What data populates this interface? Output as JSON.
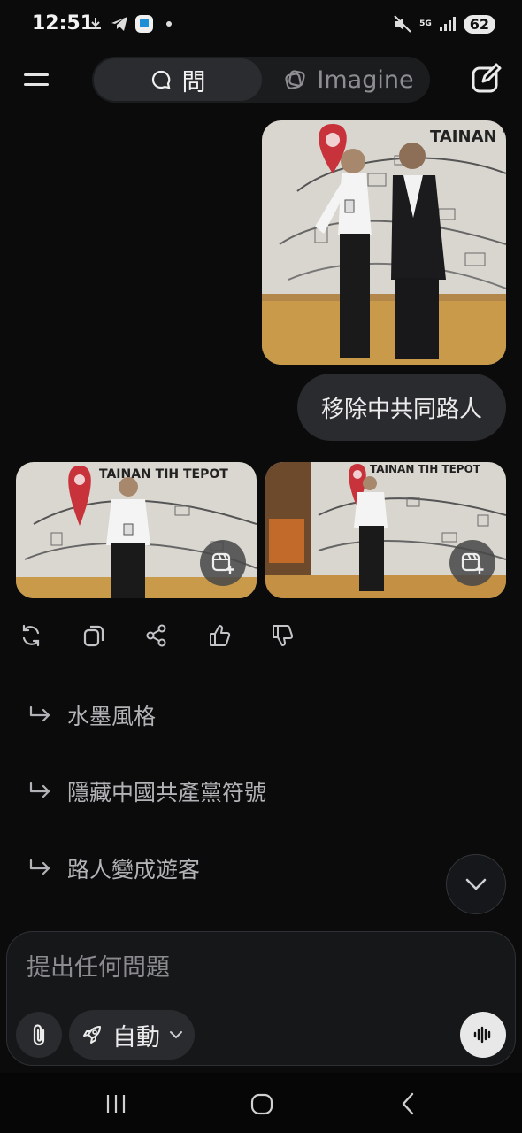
{
  "status_bar": {
    "time": "12:51",
    "left_icons": [
      "download-icon",
      "telegram-icon",
      "app-notification-icon",
      "dot-icon"
    ],
    "right_icons": [
      "mute-icon",
      "5g-icon",
      "signal-icon"
    ],
    "network": "5G",
    "battery": "62"
  },
  "topnav": {
    "tab_ask": "問",
    "tab_imagine": "Imagine",
    "active_tab": "ask"
  },
  "chat": {
    "user_message": "移除中共同路人",
    "sign_text": "TAINAN TIH TEPOT",
    "sign_text_2": "TAINAN TIH TEPOT",
    "suggestions": [
      "水墨風格",
      "隱藏中國共產黨符號",
      "路人變成遊客"
    ]
  },
  "composer": {
    "placeholder": "提出任何問題",
    "mode_label": "自動"
  },
  "colors": {
    "background": "#0b0b0c",
    "bubble": "#2a2b2e",
    "pin_red": "#c8323a"
  }
}
